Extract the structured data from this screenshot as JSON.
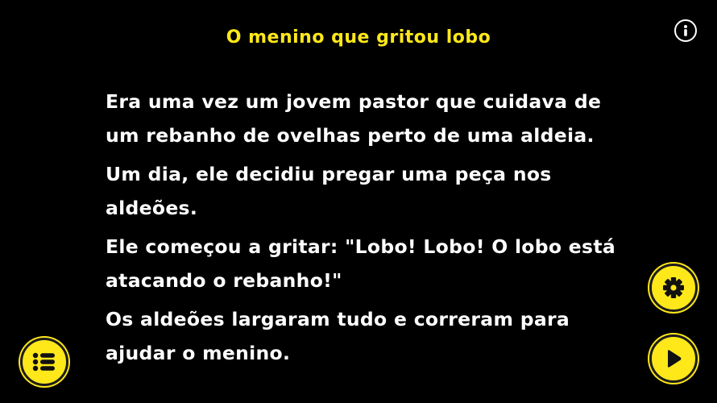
{
  "header": {
    "title": "O menino que gritou lobo"
  },
  "story": {
    "paragraphs": [
      "Era uma vez um jovem pastor que cuidava de um rebanho de ovelhas perto de uma aldeia.",
      "Um dia, ele decidiu pregar uma peça nos aldeões.",
      "Ele começou a gritar: \"Lobo! Lobo! O lobo está atacando o rebanho!\"",
      "Os aldeões largaram tudo e correram para ajudar o menino."
    ]
  },
  "icons": {
    "info": "info-icon",
    "menu": "list-icon",
    "settings": "gear-icon",
    "play": "play-icon"
  },
  "colors": {
    "background": "#000000",
    "accent": "#ffe81a",
    "text": "#ffffff"
  }
}
